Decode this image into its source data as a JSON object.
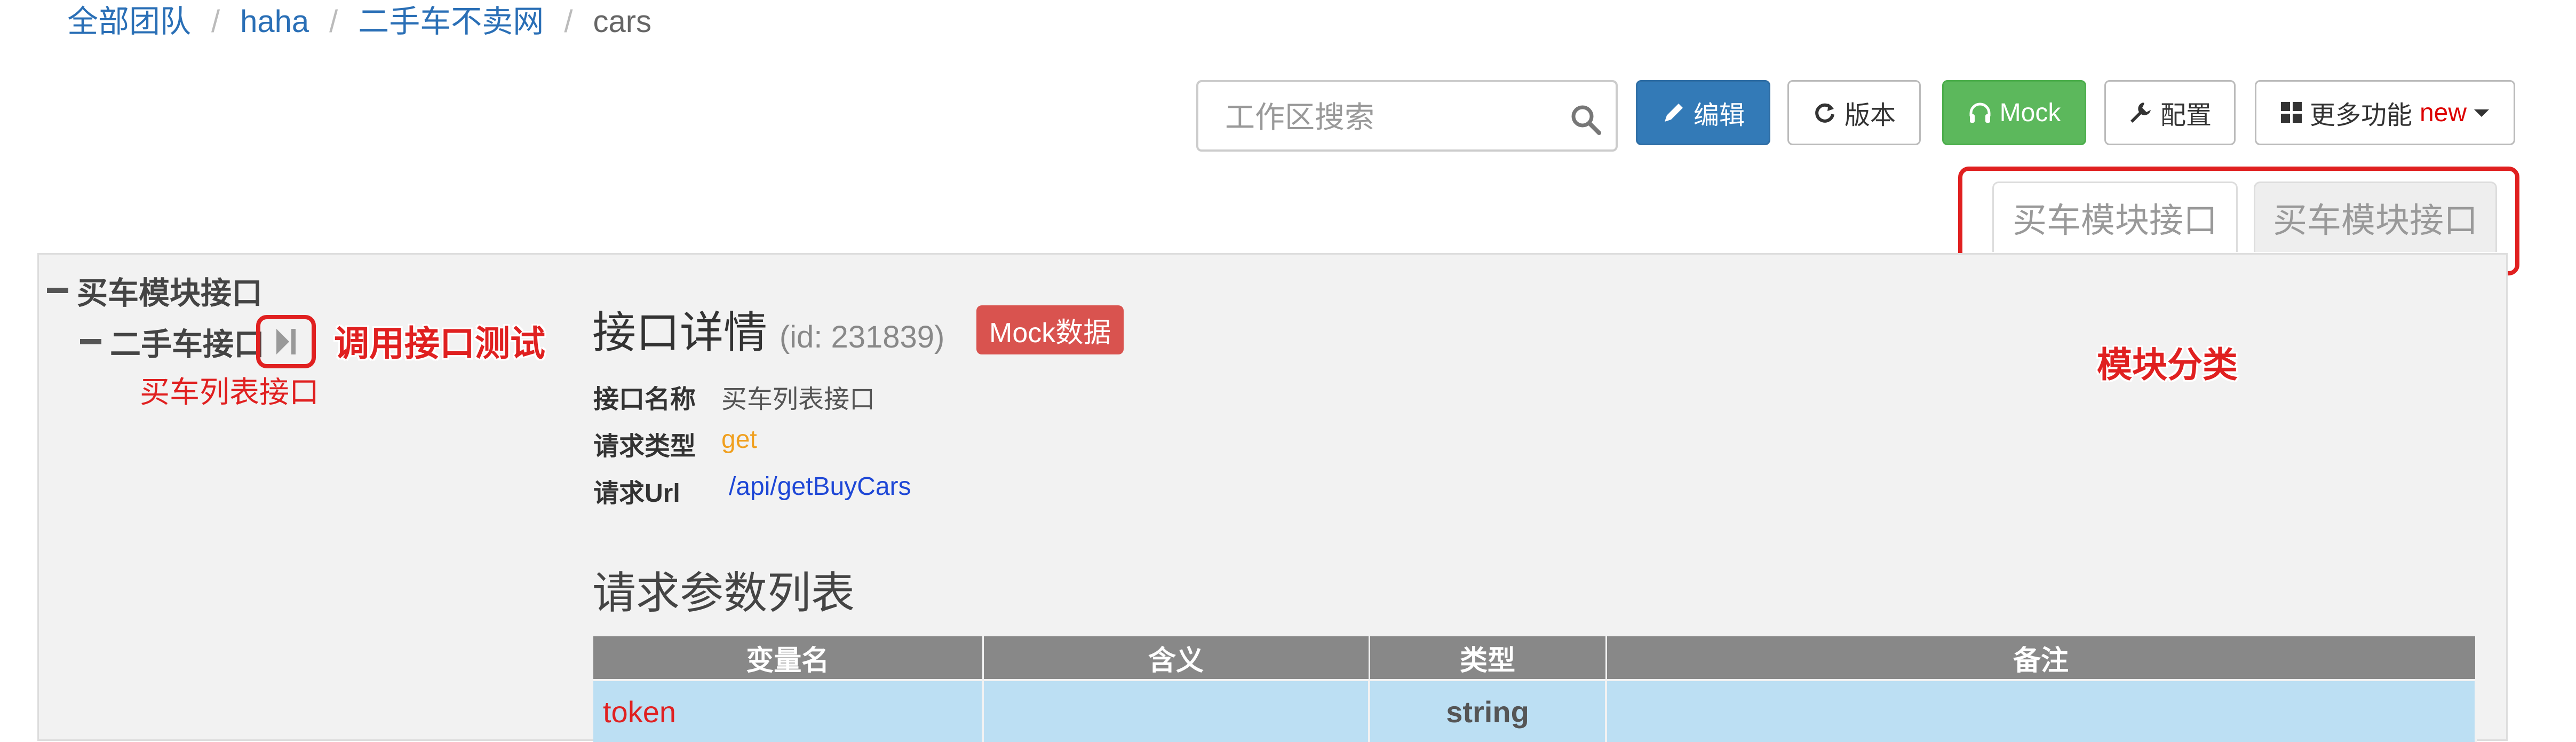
{
  "breadcrumb": {
    "items": [
      "全部团队",
      "haha",
      "二手车不卖网"
    ],
    "current": "cars",
    "separator": "/"
  },
  "toolbar": {
    "search_placeholder": "工作区搜索",
    "edit_label": "编辑",
    "version_label": "版本",
    "mock_label": "Mock",
    "config_label": "配置",
    "more_label": "更多功能",
    "more_badge": "new"
  },
  "module_tabs": [
    "买车模块接口",
    "买车模块接口"
  ],
  "tree": {
    "root_label": "买车模块接口",
    "child_label": "二手车接口",
    "leaf_label": "买车列表接口"
  },
  "detail": {
    "title": "接口详情",
    "id_text": "(id: 231839)",
    "mock_badge": "Mock数据",
    "name_key": "接口名称",
    "name_value": "买车列表接口",
    "method_key": "请求类型",
    "method_value": "get",
    "url_key": "请求Url",
    "url_value": "/api/getBuyCars",
    "params_title": "请求参数列表",
    "params_headers": [
      "变量名",
      "含义",
      "类型",
      "备注"
    ],
    "params_rows": [
      [
        "token",
        "",
        "string",
        ""
      ]
    ]
  },
  "annotations": {
    "test_label": "调用接口测试",
    "leaf_label": "买车列表接口",
    "module_label": "模块分类"
  },
  "colors": {
    "primary": "#337ab7",
    "success": "#5cb85c",
    "danger": "#d9534f",
    "annotation": "#e02020",
    "link": "#2a6fb6"
  }
}
